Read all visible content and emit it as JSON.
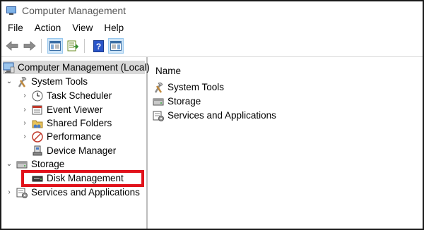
{
  "window": {
    "title": "Computer Management"
  },
  "menu": {
    "items": [
      "File",
      "Action",
      "View",
      "Help"
    ]
  },
  "toolbar": {
    "buttons": [
      "back-icon",
      "forward-icon",
      "console-tree-icon",
      "export-list-icon",
      "help-icon",
      "show-hide-action-pane-icon"
    ]
  },
  "tree": {
    "root": "Computer Management (Local)",
    "system_tools": "System Tools",
    "task_scheduler": "Task Scheduler",
    "event_viewer": "Event Viewer",
    "shared_folders": "Shared Folders",
    "performance": "Performance",
    "device_manager": "Device Manager",
    "storage": "Storage",
    "disk_management": "Disk Management",
    "services_apps": "Services and Applications",
    "selected_color": "#d9d9d9"
  },
  "main": {
    "column_header": "Name",
    "items": [
      "System Tools",
      "Storage",
      "Services and Applications"
    ]
  },
  "annotation": {
    "highlight_color": "#e1121b"
  }
}
